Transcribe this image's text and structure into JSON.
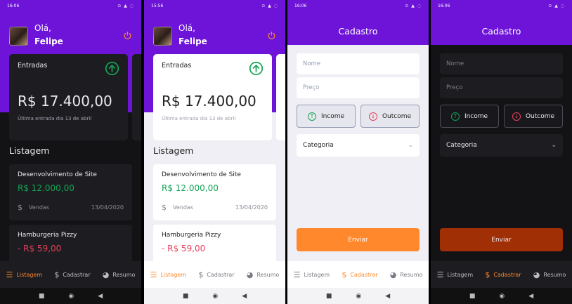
{
  "status": {
    "time": "16:06",
    "time_light": "15:56",
    "icons": "⊙ ▲ ◌"
  },
  "dashboard": {
    "greeting": "Olá,",
    "user_name": "Felipe",
    "card_label": "Entradas",
    "card_amount": "R$ 17.400,00",
    "card_subtitle": "Última entrada dia 13 de abril",
    "section_title": "Listagem",
    "transactions": [
      {
        "title": "Desenvolvimento de Site",
        "amount": "R$ 12.000,00",
        "type": "income",
        "category": "Vendas",
        "date": "13/04/2020"
      },
      {
        "title": "Hamburgeria Pizzy",
        "amount": "- R$ 59,00",
        "type": "outcome"
      }
    ]
  },
  "register": {
    "title": "Cadastro",
    "name_placeholder": "Nome",
    "price_placeholder": "Preço",
    "income_label": "Income",
    "outcome_label": "Outcome",
    "category_label": "Categoria",
    "submit_label": "Enviar"
  },
  "tabs": {
    "list": "Listagem",
    "register": "Cadastrar",
    "summary": "Resumo"
  },
  "icons": {
    "list": "list-icon",
    "register": "dollar-icon",
    "summary": "pie-chart-icon"
  },
  "colors": {
    "purple": "#6d14d8",
    "orange": "#ff872c",
    "green": "#12a454",
    "red": "#e83f5b",
    "dark_bg": "#131316",
    "light_bg": "#efeff5"
  }
}
